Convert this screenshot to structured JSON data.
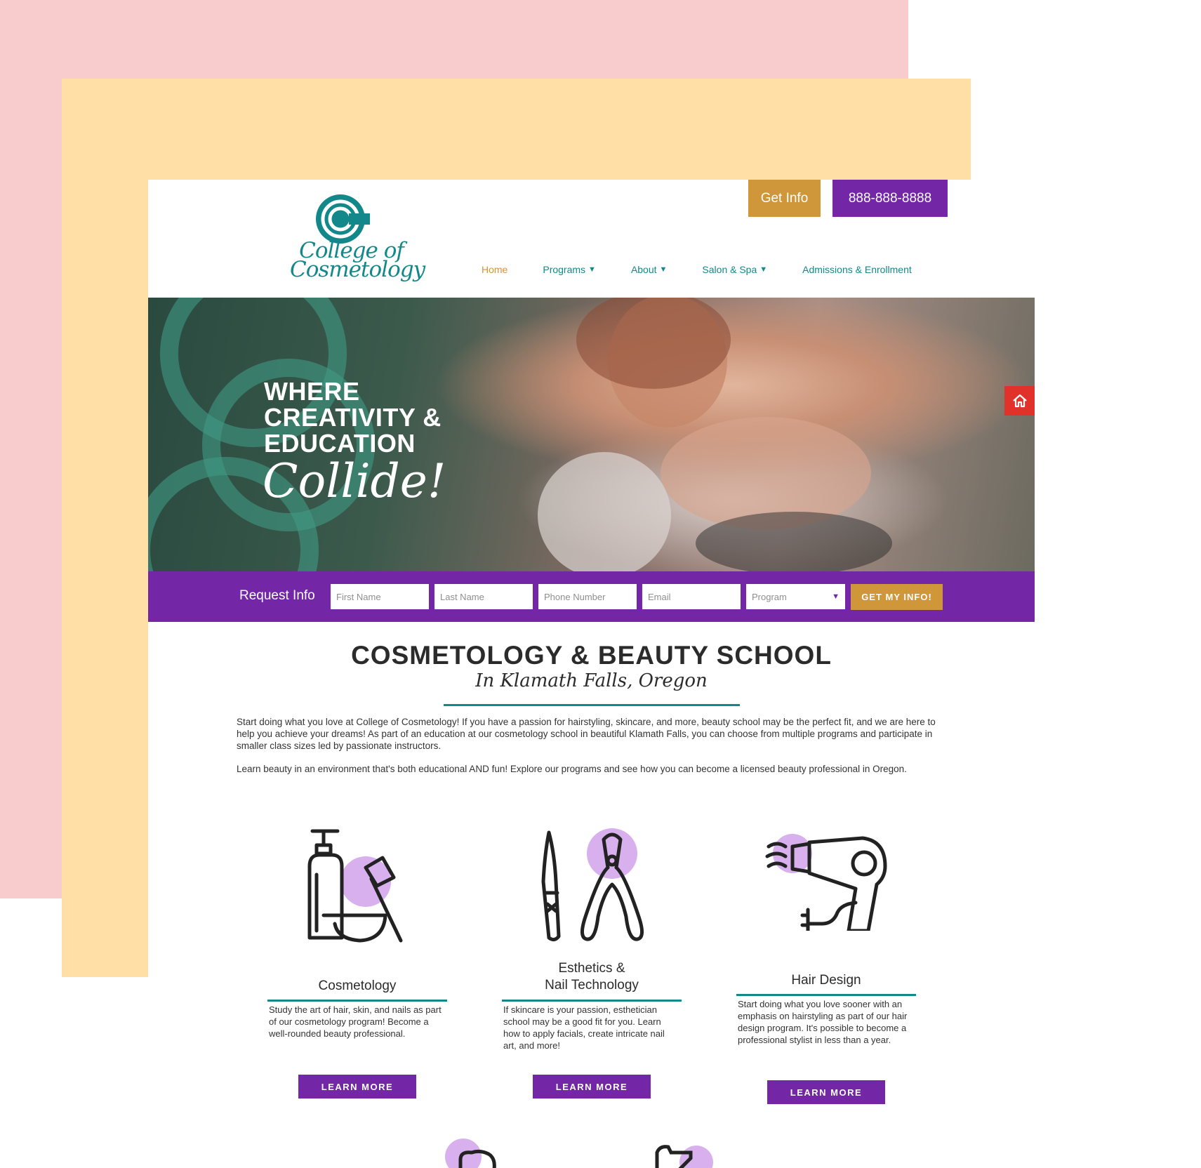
{
  "header": {
    "logo_text_line1": "College of",
    "logo_text_line2": "Cosmetology",
    "get_info_label": "Get Info",
    "phone_label": "888-888-8888"
  },
  "nav": {
    "items": [
      {
        "label": "Home",
        "dropdown": false,
        "active": true
      },
      {
        "label": "Programs",
        "dropdown": true
      },
      {
        "label": "About",
        "dropdown": true
      },
      {
        "label": "Salon & Spa",
        "dropdown": true
      },
      {
        "label": "Admissions & Enrollment",
        "dropdown": false
      }
    ],
    "caret": "▼"
  },
  "hero": {
    "headline_line1": "WHERE",
    "headline_line2": "CREATIVITY &",
    "headline_line3": "EDUCATION",
    "headline_script": "Collide!"
  },
  "form": {
    "label": "Request Info",
    "first_name_placeholder": "First Name",
    "last_name_placeholder": "Last Name",
    "phone_placeholder": "Phone Number",
    "email_placeholder": "Email",
    "program_selected": "Program",
    "submit_label": "GET MY INFO!"
  },
  "main": {
    "title": "COSMETOLOGY & BEAUTY SCHOOL",
    "subtitle": "In Klamath Falls, Oregon",
    "paragraph1": "Start doing what you love at College of Cosmetology! If you have a passion for hairstyling, skincare, and more, beauty school may be the perfect fit, and we are here to help you achieve your dreams! As part of an education at our cosmetology school in beautiful Klamath Falls, you can choose from multiple programs and participate in smaller class sizes led by passionate instructors.",
    "paragraph2": "Learn beauty in an environment that's both educational AND fun! Explore our programs and see how you can become a licensed beauty professional in Oregon."
  },
  "programs": [
    {
      "title_line1": "Cosmetology",
      "title_line2": "",
      "description": "Study the art of hair, skin, and nails as part of our cosmetology program! Become a well-rounded beauty professional.",
      "button_label": "LEARN MORE",
      "icon": "cosmetology-icon"
    },
    {
      "title_line1": "Esthetics &",
      "title_line2": "Nail Technology",
      "description": "If skincare is your passion, esthetician school may be a good fit for you. Learn how to apply facials, create intricate nail art, and more!",
      "button_label": "LEARN MORE",
      "icon": "nail-tools-icon"
    },
    {
      "title_line1": "Hair Design",
      "title_line2": "",
      "description": "Start doing what you love sooner with an emphasis on hairstyling as part of our hair design program. It's possible to become a professional stylist in less than a year.",
      "button_label": "LEARN MORE",
      "icon": "hair-dryer-icon"
    }
  ],
  "colors": {
    "teal": "#13888a",
    "purple": "#7326a6",
    "gold": "#d0963a",
    "accent_circle": "#d9b0ee",
    "red": "#e0312b",
    "bg_pink": "#f8cbcc",
    "bg_yellow": "#ffdfa6"
  }
}
